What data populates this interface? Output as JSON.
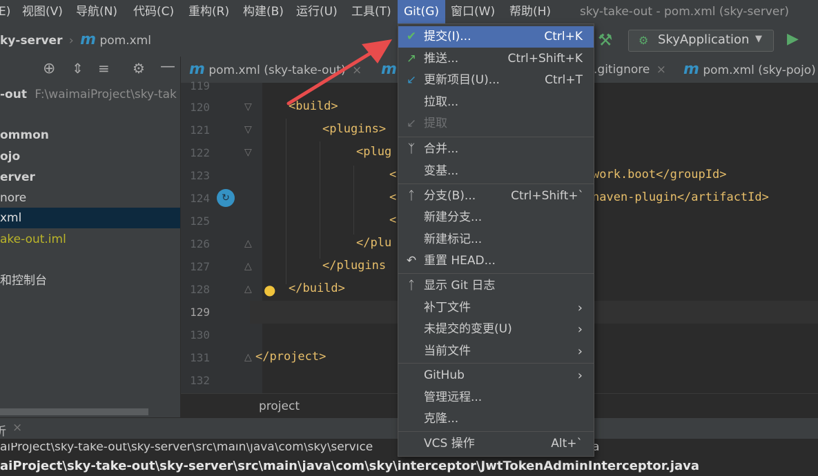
{
  "menubar": {
    "items": [
      "E)",
      "视图(V)",
      "导航(N)",
      "代码(C)",
      "重构(R)",
      "构建(B)",
      "运行(U)",
      "工具(T)",
      "Git(G)",
      "窗口(W)",
      "帮助(H)"
    ],
    "window_title": "sky-take-out - pom.xml (sky-server)"
  },
  "toolbar": {
    "crumb_project": "ky-server",
    "crumb_file": "pom.xml",
    "run_config": "SkyApplication"
  },
  "project_tree": {
    "root_name": "-out",
    "root_path": "F:\\waimaiProject\\sky-tak",
    "items": [
      "ommon",
      "ojo",
      "erver",
      "nore",
      "xml",
      "ake-out.iml",
      "和控制台"
    ]
  },
  "editor": {
    "tabs": [
      "pom.xml (sky-take-out)",
      ".gitignore",
      "pom.xml (sky-pojo)"
    ],
    "line_numbers": [
      "119",
      "120",
      "121",
      "122",
      "123",
      "124",
      "125",
      "126",
      "127",
      "128",
      "129",
      "130",
      "131",
      "132"
    ],
    "lines": {
      "l120": "<build>",
      "l121": "<plugins>",
      "l122": "<plug",
      "l123a": "<",
      "l123b": "work.boot</groupId>",
      "l124a": "<",
      "l124b": "naven-plugin</artifactId>",
      "l125": "<",
      "l126": "</plu",
      "l127": "</plugins",
      "l128": "</build>",
      "l131": "</project>"
    },
    "breadcrumb": "project"
  },
  "bottom": {
    "tab_label": "折",
    "line1": "aiProject\\sky-take-out\\sky-server\\src\\main\\java\\com\\sky\\service",
    "line1_tail": "a",
    "line2": "aiProject\\sky-take-out\\sky-server\\src\\main\\java\\com\\sky\\interceptor\\JwtTokenAdminInterceptor.java"
  },
  "git_menu": {
    "commit": "提交(I)...",
    "commit_sc": "Ctrl+K",
    "push": "推送...",
    "push_sc": "Ctrl+Shift+K",
    "update": "更新项目(U)...",
    "update_sc": "Ctrl+T",
    "pull": "拉取...",
    "fetch": "提取",
    "merge": "合并...",
    "rebase": "变基...",
    "branches": "分支(B)...",
    "branches_sc": "Ctrl+Shift+`",
    "new_branch": "新建分支...",
    "new_tag": "新建标记...",
    "reset_head": "重置 HEAD...",
    "show_log": "显示 Git 日志",
    "patch": "补丁文件",
    "uncommitted": "未提交的变更(U)",
    "current_file": "当前文件",
    "github": "GitHub",
    "remotes": "管理远程...",
    "clone": "克隆...",
    "vcs_ops": "VCS 操作",
    "vcs_ops_sc": "Alt+`"
  },
  "colors": {
    "accent": "#4b6eaf",
    "arrow": "#e84c4c",
    "check": "#5fb865",
    "tag": "#e8bf6a"
  }
}
